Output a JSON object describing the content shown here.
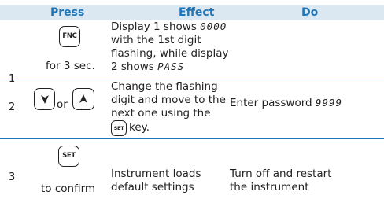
{
  "header": {
    "press": "Press",
    "effect": "Effect",
    "do": "Do"
  },
  "rows": [
    {
      "num": "1",
      "key": "FNC",
      "press_note": "for 3 sec.",
      "effect": {
        "l1_prefix": "Display 1 shows ",
        "l1_seg": "0000",
        "l2": "with the 1st digit",
        "l3": "flashing, while display",
        "l4_prefix": "2 shows ",
        "l4_seg": "PASS"
      },
      "do": ""
    },
    {
      "num": "2",
      "or": "or",
      "effect": {
        "l1": "Change the flashing",
        "l2": "digit and move to the",
        "l3": "next one using the",
        "l4_key": "SET",
        "l4_suffix": "key."
      },
      "do_prefix": "Enter password ",
      "do_seg": "9999"
    },
    {
      "num": "3",
      "key": "SET",
      "press_note": "to confirm",
      "effect": {
        "l1": "Instrument loads",
        "l2": "default settings"
      },
      "do": {
        "l1": "Turn off and restart",
        "l2": "the instrument"
      }
    }
  ],
  "icons": {
    "key_fnc": "fnc-key-icon",
    "key_down": "down-arrow-key-icon",
    "key_up": "up-arrow-key-icon",
    "key_set": "set-key-icon"
  },
  "colors": {
    "header_bg": "#dbe7f1",
    "header_text": "#1f76b7",
    "rule": "#1f76b7"
  }
}
